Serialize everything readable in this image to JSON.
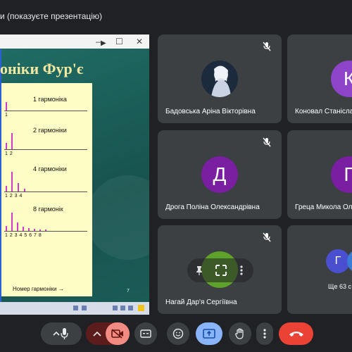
{
  "meeting": {
    "presenter_title": "и (показуєте презентацію)"
  },
  "presentation": {
    "slide_title": "оніки Фур'є",
    "page_number": "7",
    "window_buttons": [
      "—",
      "☐",
      "✕"
    ],
    "harmonics": [
      {
        "label": "1 гармоніка",
        "ticks": "1"
      },
      {
        "label": "2 гармоніки",
        "ticks": "1  2"
      },
      {
        "label": "4 гармоніки",
        "ticks": "1  2  3  4"
      },
      {
        "label": "8 гармонік",
        "ticks": "1  2  3 4 5 6 7 8"
      }
    ],
    "x_axis_label": "Номер гармоніки  →"
  },
  "participants": [
    {
      "name": "Бадовська Аріна Вікторівна",
      "initial": "",
      "avatar_kind": "photo",
      "muted": true
    },
    {
      "name": "Коновал Станісла",
      "initial": "К",
      "avatar_color": "#8e44c9",
      "muted": false
    },
    {
      "name": "Дрога Поліна Олександрівна",
      "initial": "Д",
      "avatar_color": "#7b1fa2",
      "muted": true
    },
    {
      "name": "Греца Микола Ол",
      "initial": "Г",
      "avatar_color": "#7b1fa2",
      "muted": false
    },
    {
      "name": "Нагай Дар'я Сергіївна",
      "initial": "",
      "avatar_kind": "talking-green",
      "muted": true
    }
  ],
  "others": {
    "label": "Ще 63 с",
    "avatar_initial": "Г",
    "avatar_color": "#4a4fd0"
  },
  "controls": {
    "mic": "microphone",
    "camera": "camera-off",
    "captions": "captions",
    "emoji": "emoji",
    "present": "present-screen",
    "hand": "raise-hand",
    "more": "more-options",
    "leave": "leave-call",
    "colors": {
      "dark": "#3c4043",
      "camera_off": "#f28b82",
      "present_bg": "#8ab4f8",
      "leave": "#ea4335"
    }
  }
}
